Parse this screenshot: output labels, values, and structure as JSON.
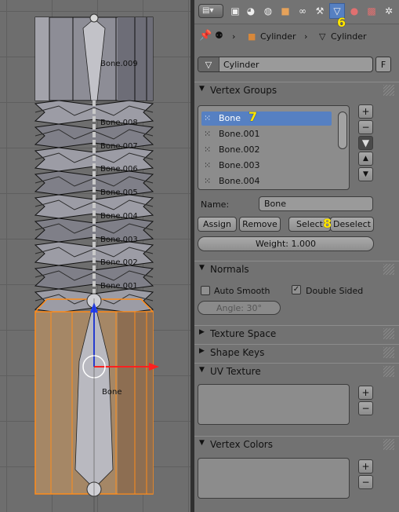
{
  "viewport": {
    "bone_labels": [
      "Bone.009",
      "Bone.008",
      "Bone.007",
      "Bone.006",
      "Bone.005",
      "Bone.004",
      "Bone.003",
      "Bone.002",
      "Bone.001",
      "Bone"
    ]
  },
  "header": {
    "editor_type_icon": "properties-editor-icon",
    "tabs": [
      {
        "icon": "render-icon",
        "active": false
      },
      {
        "icon": "scene-icon",
        "active": false
      },
      {
        "icon": "world-icon",
        "active": false
      },
      {
        "icon": "object-icon",
        "active": false
      },
      {
        "icon": "constraints-icon",
        "active": false
      },
      {
        "icon": "modifier-wrench-icon",
        "active": false
      },
      {
        "icon": "mesh-data-icon",
        "active": true
      },
      {
        "icon": "material-icon",
        "active": false
      },
      {
        "icon": "texture-icon",
        "active": false
      },
      {
        "icon": "particles-icon",
        "active": false
      }
    ],
    "annotation_6": "6"
  },
  "breadcrumb": {
    "object": "Cylinder",
    "mesh": "Cylinder"
  },
  "mesh_field": {
    "name": "Cylinder",
    "fake_user": "F"
  },
  "vertex_groups": {
    "title": "Vertex Groups",
    "items": [
      "Bone",
      "Bone.001",
      "Bone.002",
      "Bone.003",
      "Bone.004"
    ],
    "selected_index": 0,
    "annotation_7": "7",
    "name_label": "Name:",
    "name_value": "Bone",
    "assign": "Assign",
    "remove": "Remove",
    "select": "Select",
    "deselect": "Deselect",
    "annotation_8": "8",
    "weight": "Weight: 1.000"
  },
  "normals": {
    "title": "Normals",
    "auto_smooth": "Auto Smooth",
    "auto_smooth_checked": false,
    "double_sided": "Double Sided",
    "double_sided_checked": true,
    "angle": "Angle: 30°"
  },
  "texture_space": {
    "title": "Texture Space"
  },
  "shape_keys": {
    "title": "Shape Keys"
  },
  "uv_texture": {
    "title": "UV Texture"
  },
  "vertex_colors": {
    "title": "Vertex Colors"
  },
  "colors": {
    "selection_blue": "#5680c2",
    "mesh_orange": "#ff8c1a",
    "annotation_yellow": "#ffe600"
  }
}
